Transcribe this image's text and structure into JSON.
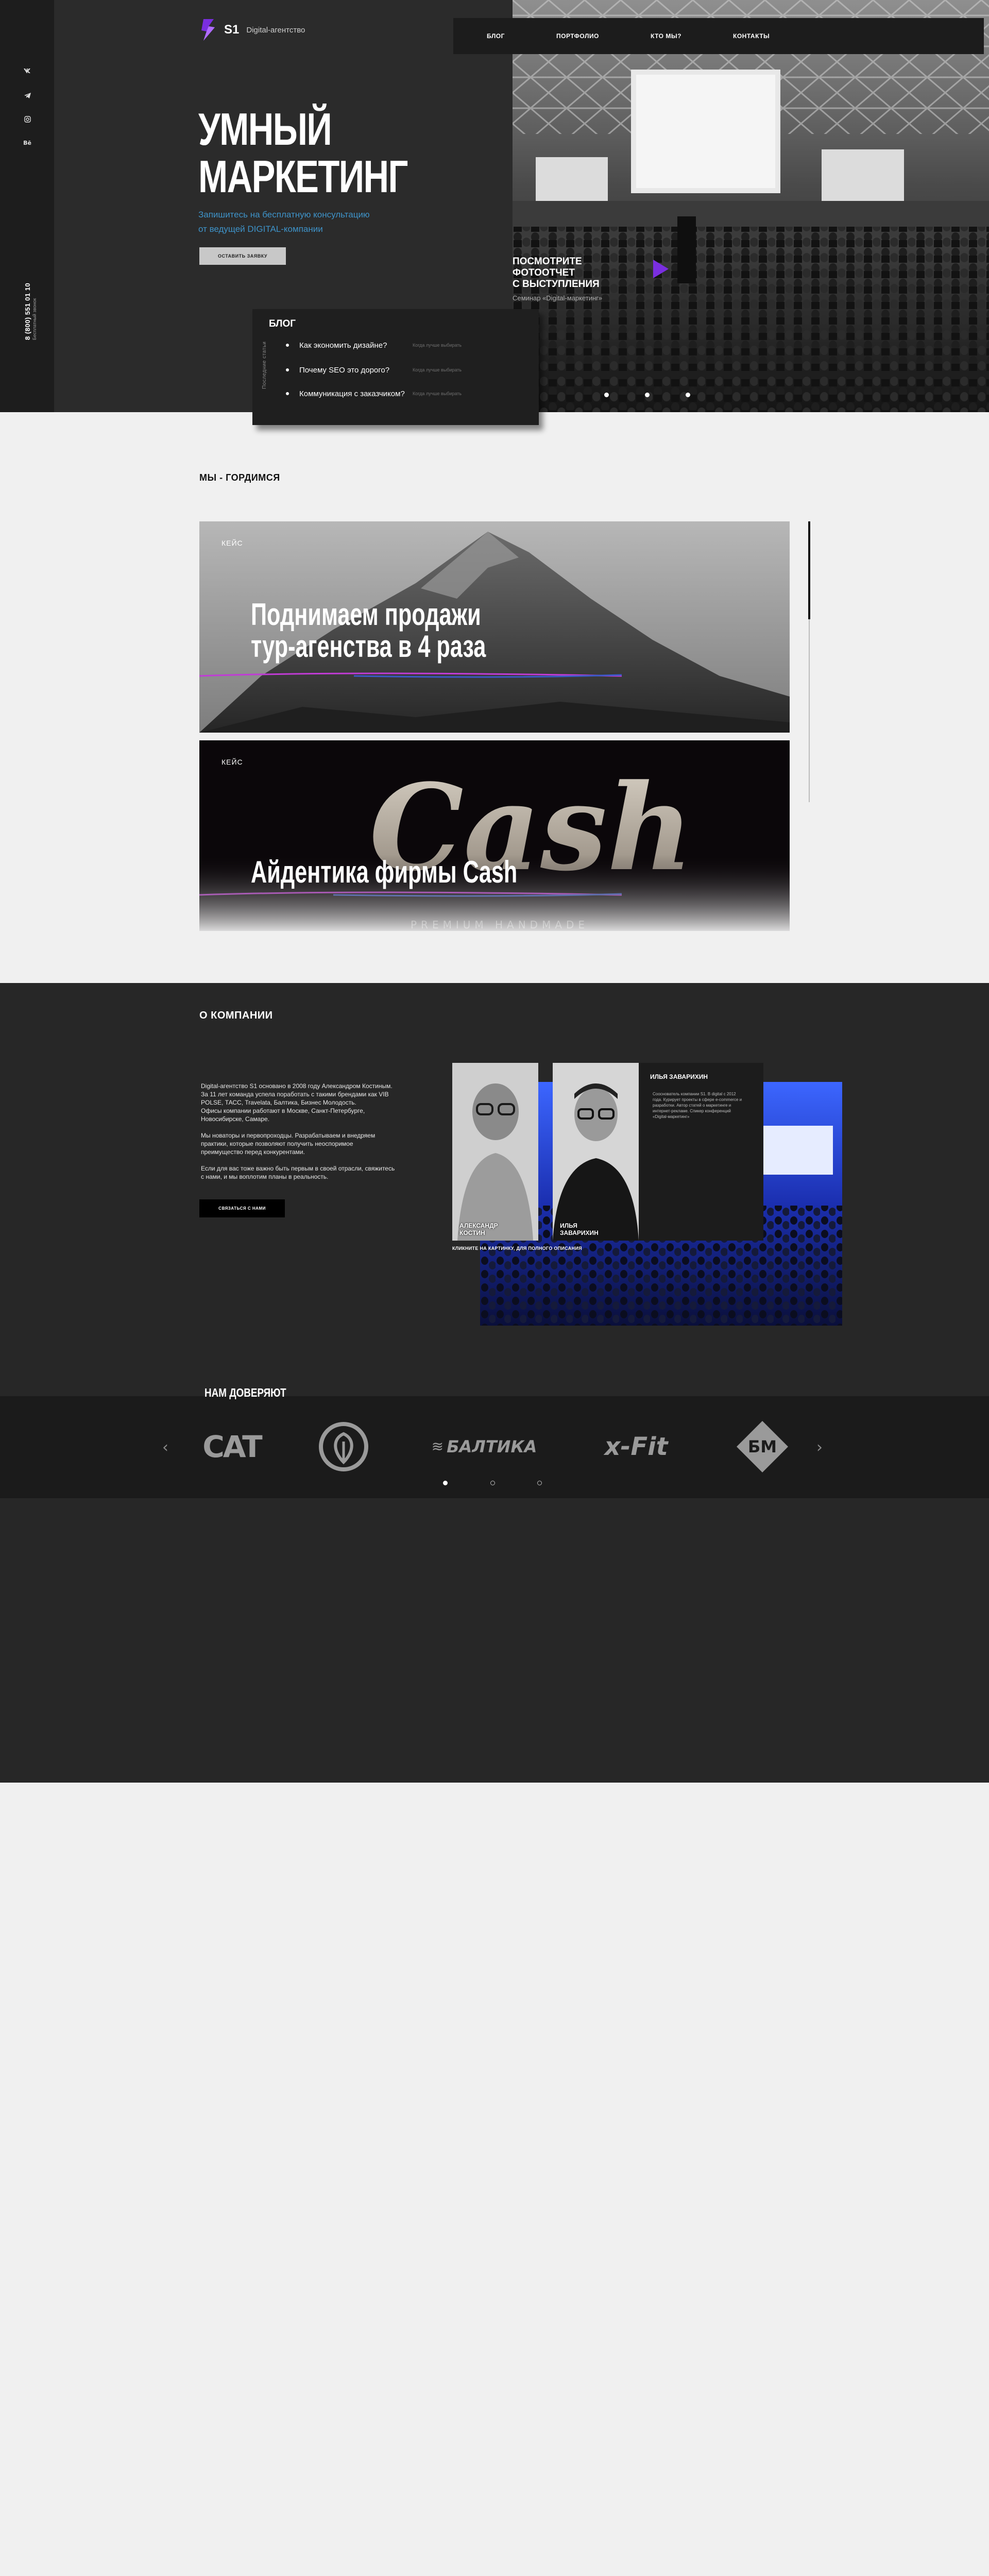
{
  "header": {
    "logo_brand": "S1",
    "logo_sub": "Digital-агентство",
    "nav": [
      "БЛОГ",
      "ПОРТФОЛИО",
      "КТО МЫ?",
      "КОНТАКТЫ"
    ]
  },
  "rail": {
    "socials": [
      "vk-icon",
      "telegram-icon",
      "instagram-icon",
      "behance-icon"
    ],
    "phone": "8 (800) 551 01 10",
    "phone_note": "Бесплатный звонок"
  },
  "hero": {
    "title_line1": "УМНЫЙ",
    "title_line2": "МАРКЕТИНГ",
    "subtitle_line1": "Запишитесь на бесплатную консультацию",
    "subtitle_line2": "от ведущей DIGITAL-компании",
    "cta": "ОСТАВИТЬ ЗАЯВКУ",
    "photo_caption_line1": "ПОСМОТРИТЕ ФОТООТЧЕТ",
    "photo_caption_line2": "С ВЫСТУПЛЕНИЯ",
    "photo_caption_sub": "Семинар «Digital-маркетинг»",
    "slides": 3,
    "active_slide": 1
  },
  "blog": {
    "title": "БЛОГ",
    "side_label": "Последние статьи",
    "items": [
      {
        "title": "Как экономить дизайне?",
        "date": "Когда лучше выбирать"
      },
      {
        "title": "Почему SEO это дорого?",
        "date": "Когда лучше выбирать"
      },
      {
        "title": "Коммуникация с заказчиком?",
        "date": "Когда лучше выбирать"
      }
    ]
  },
  "pride": {
    "title": "МЫ - ГОРДИМСЯ",
    "cases": [
      {
        "label": "КЕЙС",
        "headline_line1": "Поднимаем продажи",
        "headline_line2": "тур-агенства в 4 раза"
      },
      {
        "label": "КЕЙС",
        "headline_line1": "Айдентика фирмы Cash",
        "headline_line2": ""
      }
    ],
    "case2_logo": "Cash",
    "case2_tag": "PREMIUM HANDMADE"
  },
  "about": {
    "title": "О КОМПАНИИ",
    "paragraphs": [
      "Digital-агентство S1 основано в 2008 году Александром Костиным. За 11 лет команда успела поработать с такими брендами как VIB POLSE, ТАСС, Travelata, Балтика, Бизнес Молодость.",
      "Офисы компании работают в Москве, Санкт-Петербурге, Новосибирске, Самаре.",
      "Мы новаторы и первопроходцы. Разрабатываем и внедряем практики, которые позволяют получить неоспоримое преимущество перед конкурентами.",
      "Если для вас тоже важно быть первым в своей отрасли, свяжитесь с нами, и мы воплотим планы в реальность."
    ],
    "cta": "СВЯЗАТЬСЯ С НАМИ",
    "team": [
      {
        "name_line1": "АЛЕКСАНДР",
        "name_line2": "КОСТИН"
      },
      {
        "name_line1": "ИЛЬЯ",
        "name_line2": "ЗАВАРИХИН"
      }
    ],
    "bio_name": "ИЛЬЯ ЗАВАРИХИН",
    "bio_text": "Сооснователь компании S1. В digital с 2012 года. Курирует проекты в сфере e-commerce и разработки. Автор статей о маркетинге и интернет-рекламе. Спикер конференций «Digital-маркетинг»",
    "hint": "КЛИКНИТЕ НА КАРТИНКУ, ДЛЯ ПОЛНОГО ОПИСАНИЯ"
  },
  "partners": {
    "title": "НАМ ДОВЕРЯЮТ",
    "logos": [
      "CAT",
      "Ив Роше",
      "БАЛТИКА",
      "x-Fit",
      "БМ"
    ],
    "pages": 3,
    "active_page": 1
  },
  "colors": {
    "accent_blue": "#3e93c9",
    "brand_purple": "#7a2ee0",
    "dark_bg": "#272727"
  }
}
